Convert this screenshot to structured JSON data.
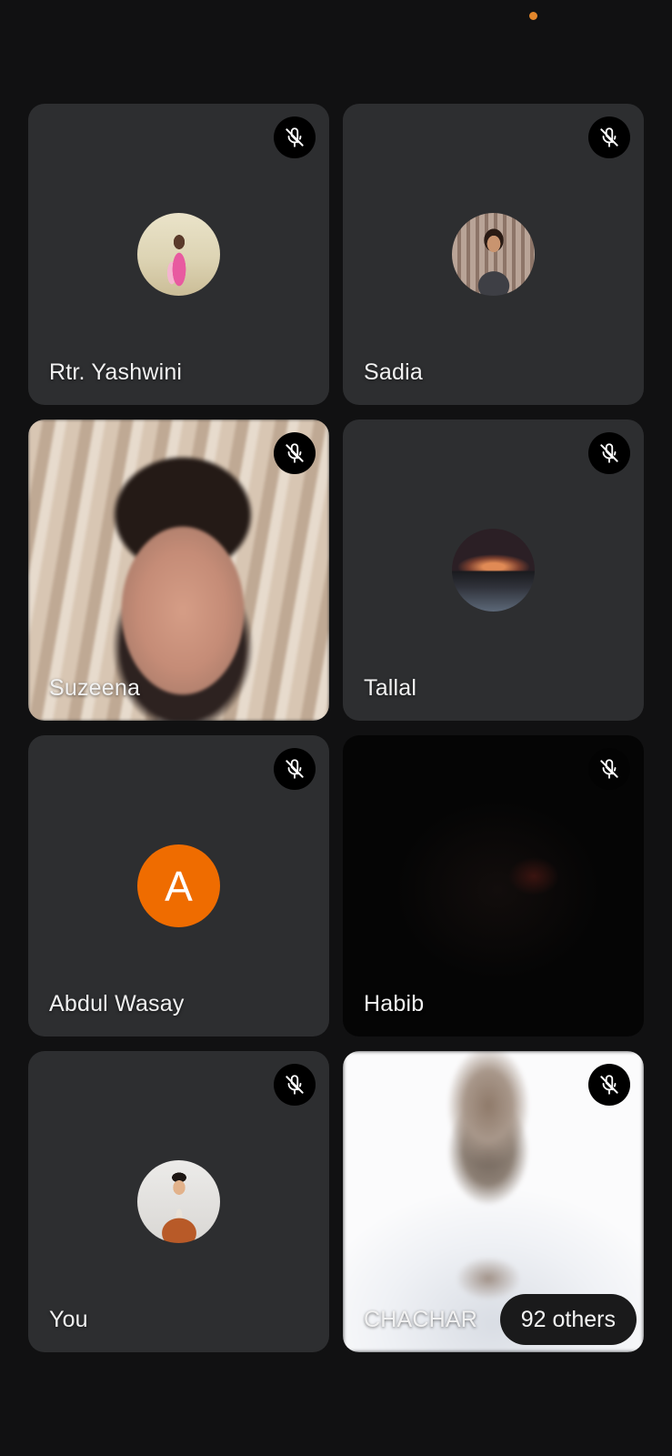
{
  "colors": {
    "background": "#111112",
    "tile": "#2d2e30",
    "status_dot": "#e2862b",
    "avatar_letter_bg": "#ef6c00"
  },
  "participants": [
    {
      "name": "Rtr. Yashwini",
      "muted": true,
      "media": "avatar-photo"
    },
    {
      "name": "Sadia",
      "muted": true,
      "media": "avatar-photo"
    },
    {
      "name": "Suzeena",
      "muted": true,
      "media": "video"
    },
    {
      "name": "Tallal",
      "muted": true,
      "media": "avatar-photo"
    },
    {
      "name": "Abdul Wasay",
      "muted": true,
      "media": "avatar-letter",
      "avatar_letter": "A"
    },
    {
      "name": "Habib",
      "muted": true,
      "media": "video"
    },
    {
      "name": "You",
      "muted": true,
      "media": "avatar-photo"
    },
    {
      "name": "CHACHAR",
      "muted": true,
      "media": "video"
    }
  ],
  "others": {
    "label": "92 others"
  },
  "icons": {
    "mute": "mic-off-icon"
  }
}
